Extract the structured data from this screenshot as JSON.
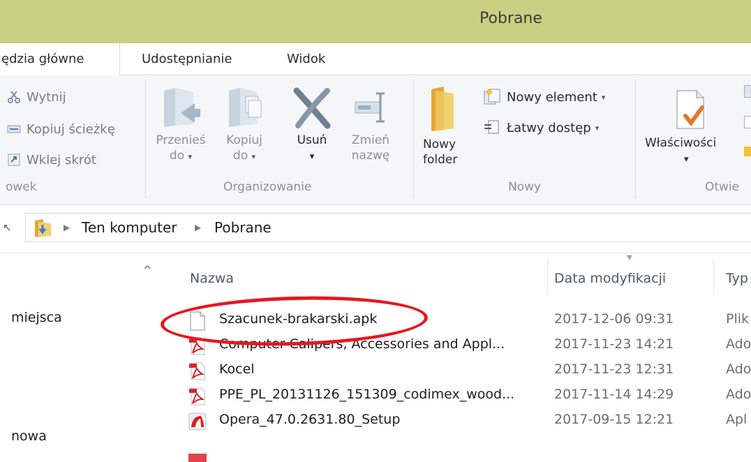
{
  "window": {
    "title": "Pobrane"
  },
  "tabs": [
    {
      "label": "ędzia główne"
    },
    {
      "label": "Udostępnianie"
    },
    {
      "label": "Widok"
    }
  ],
  "ribbon": {
    "clipboard": {
      "cut": "Wytnij",
      "copy_path": "Kopiuj ścieżkę",
      "paste_shortcut": "Wklej skrót",
      "group_label": "owek"
    },
    "organize": {
      "move_line1": "Przenieś",
      "move_line2": "do",
      "copy_line1": "Kopiuj",
      "copy_line2": "do",
      "delete": "Usuń",
      "rename_line1": "Zmień",
      "rename_line2": "nazwę",
      "group_label": "Organizowanie"
    },
    "new": {
      "new_folder_line1": "Nowy",
      "new_folder_line2": "folder",
      "new_item": "Nowy element",
      "easy_access": "Łatwy dostęp",
      "group_label": "Nowy"
    },
    "open": {
      "properties": "Właściwości",
      "group_label": "Otwie"
    }
  },
  "address": {
    "parts": [
      "Ten komputer",
      "Pobrane"
    ]
  },
  "nav": {
    "items": [
      "miejsca",
      "nowa"
    ]
  },
  "columns": {
    "name": "Nazwa",
    "date": "Data modyfikacji",
    "type": "Typ"
  },
  "files": [
    {
      "name": "Szacunek-brakarski.apk",
      "date": "2017-12-06 09:31",
      "type": "Plik",
      "icon": "blank-file-icon"
    },
    {
      "name": "Computer Calipers, Accessories and Appl...",
      "date": "2017-11-23 14:21",
      "type": "Ado",
      "icon": "pdf-icon"
    },
    {
      "name": "Kocel",
      "date": "2017-11-23 12:31",
      "type": "Ado",
      "icon": "pdf-icon"
    },
    {
      "name": "PPE_PL_20131126_151309_codimex_wood...",
      "date": "2017-11-14 14:29",
      "type": "Ado",
      "icon": "pdf-icon"
    },
    {
      "name": "Opera_47.0.2631.80_Setup",
      "date": "2017-09-15 12:21",
      "type": "Apl",
      "icon": "opera-icon"
    }
  ],
  "colors": {
    "titlebar": "#c9d081",
    "highlight": "#e8161d"
  }
}
